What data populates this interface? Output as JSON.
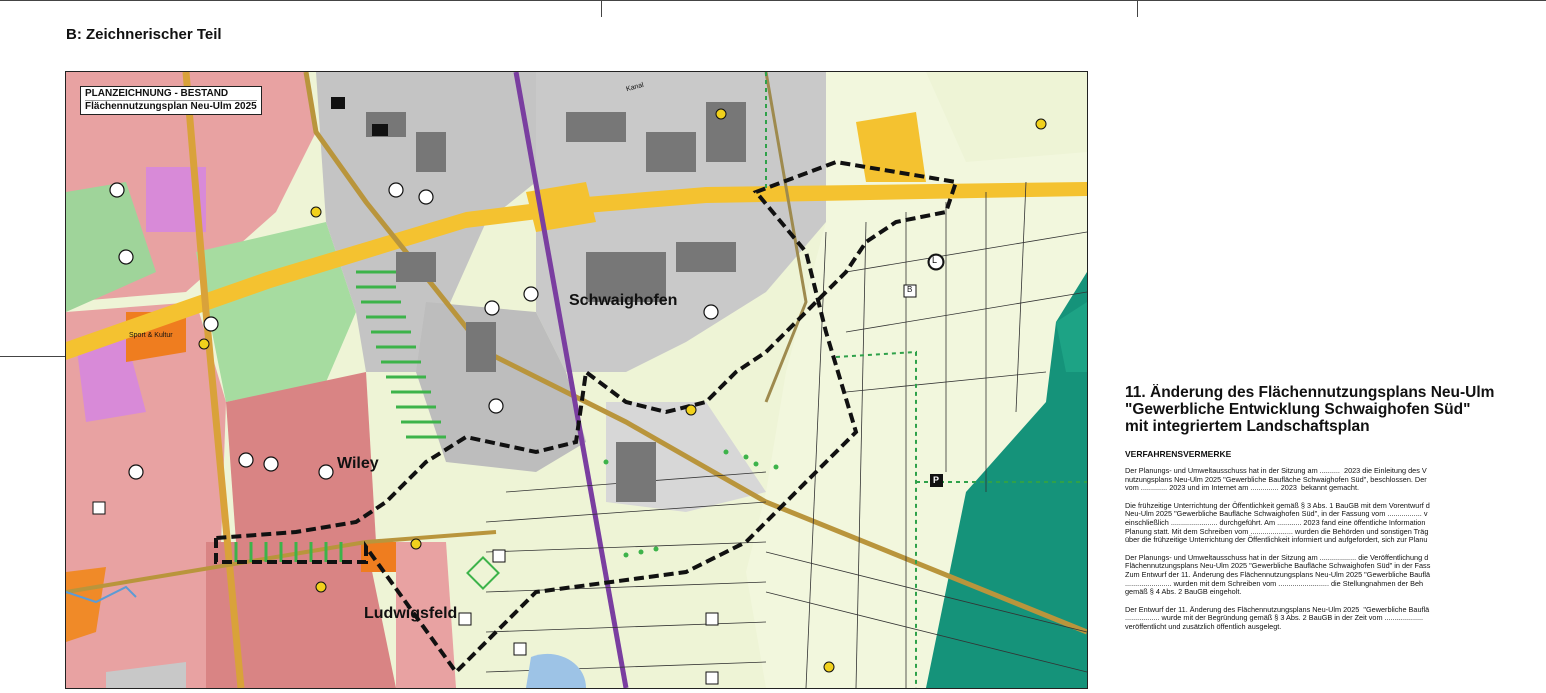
{
  "section_title": "B: Zeichnerischer Teil",
  "map": {
    "legend_line1": "PLANZEICHNUNG - BESTAND",
    "legend_line2": "Flächennutzungsplan Neu-Ulm 2025",
    "places": {
      "schwaighofen": "Schwaighofen",
      "wiley": "Wiley",
      "ludwigsfeld": "Ludwigsfeld"
    },
    "labels": {
      "sport": "Sport & Kultur",
      "kanal": "Kanal",
      "p_marker": "P",
      "b_marker": "B",
      "l_marker": "L"
    }
  },
  "panel": {
    "title_line1": "11. Änderung des Flächennutzungsplans Neu-Ulm",
    "title_line2": "\"Gewerbliche Entwicklung Schwaighofen Süd\"",
    "title_line3": "mit integriertem Landschaftsplan",
    "heading": "VERFAHRENSVERMERKE",
    "paragraphs": [
      "Der Planungs- und Umweltausschuss hat in der Sitzung am ..........  2023 die Einleitung des V\nnutzungsplans Neu-Ulm 2025 \"Gewerbliche Baufläche Schwaighofen Süd\", beschlossen. Der\nvom ............. 2023 und im Internet am .............. 2023  bekannt gemacht.",
      "Die frühzeitige Unterrichtung der Öffentlichkeit gemäß § 3 Abs. 1 BauGB mit dem Vorentwurf d\nNeu-Ulm 2025 \"Gewerbliche Baufläche Schwaighofen Süd\", in der Fassung vom ................. v\neinschließlich ....................... durchgeführt. Am ............ 2023 fand eine öffentliche Information\nPlanung statt. Mit dem Schreiben vom ..................... wurden die Behörden und sonstigen Träg\nüber die frühzeitige Unterrichtung der Öffentlichkeit informiert und aufgefordert, sich zur Planu",
      "Der Planungs- und Umweltausschuss hat in der Sitzung am .................. die Veröffentlichung d\nFlächennutzungsplans Neu-Ulm 2025 \"Gewerbliche Baufläche Schwaighofen Süd\" in der Fass\nZum Entwurf der 11. Änderung des Flächennutzungsplans Neu-Ulm 2025 \"Gewerbliche Bauflä\n....................... wurden mit dem Schreiben vom ......................... die Stellungnahmen der Beh\ngemäß § 4 Abs. 2 BauGB eingeholt.",
      "Der Entwurf der 11. Änderung des Flächennutzungsplans Neu-Ulm 2025  \"Gewerbliche Bauflä\n................. wurde mit der Begründung gemäß § 3 Abs. 2 BauGB in der Zeit vom ...................\nveröffentlicht und zusätzlich öffentlich ausgelegt."
    ]
  }
}
